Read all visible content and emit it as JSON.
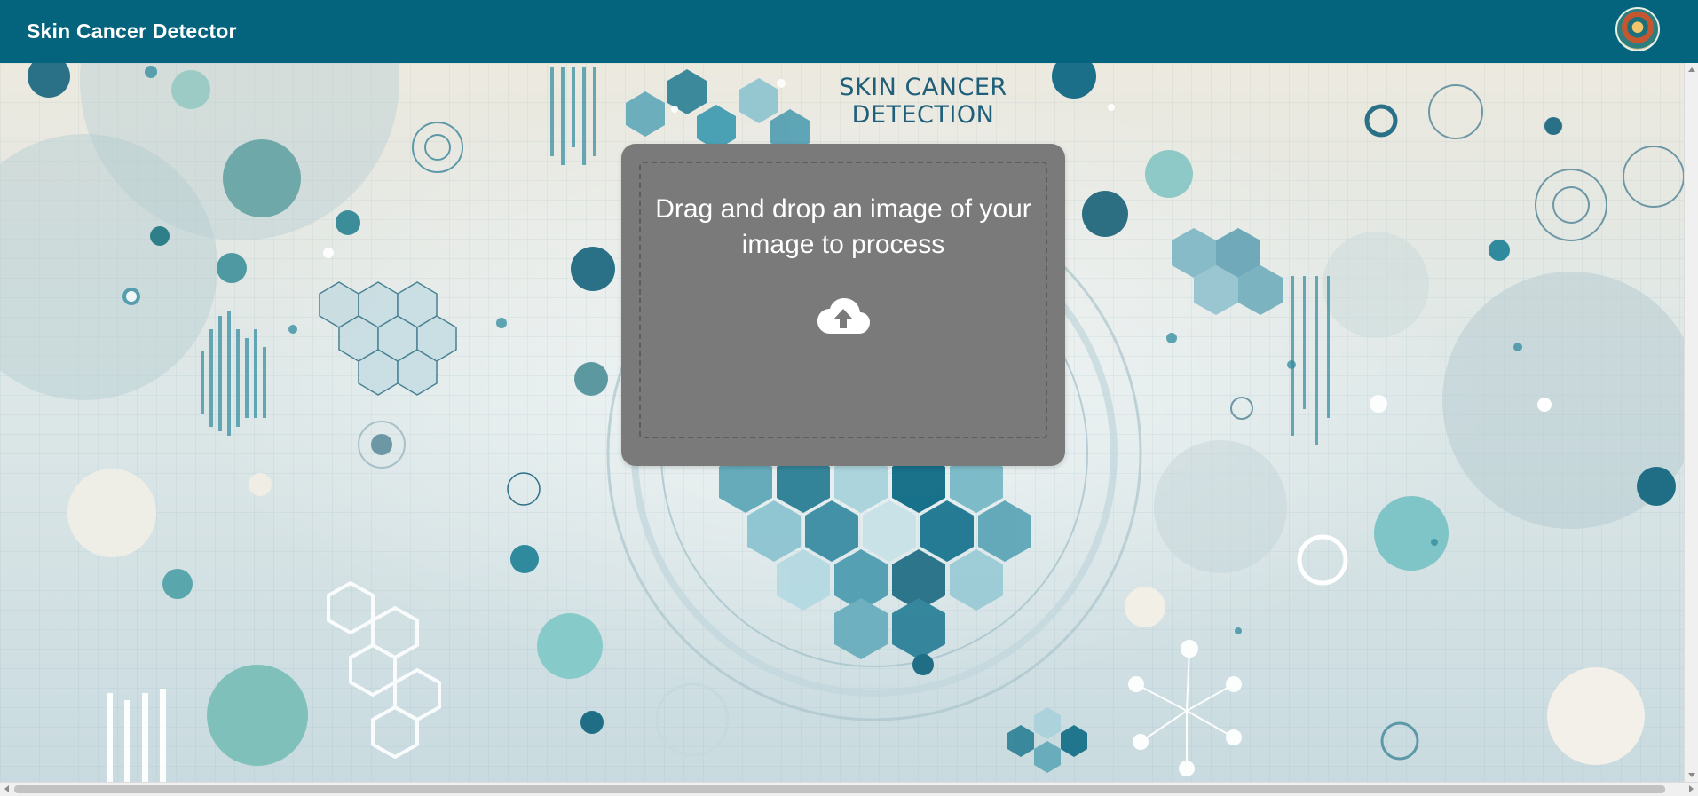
{
  "header": {
    "title": "Skin Cancer Detector",
    "avatar_icon": "user-avatar-icon"
  },
  "background": {
    "poster_title_line1": "SKIN CANCER",
    "poster_title_line2": "DETECTION"
  },
  "upload": {
    "prompt": "Drag and drop an image of your image to process",
    "icon": "cloud-upload-icon"
  },
  "colors": {
    "header_bg": "#04647e",
    "panel_bg": "#7a7a7a",
    "text_light": "#ffffff",
    "accent_teal": "#2f8a9e"
  }
}
